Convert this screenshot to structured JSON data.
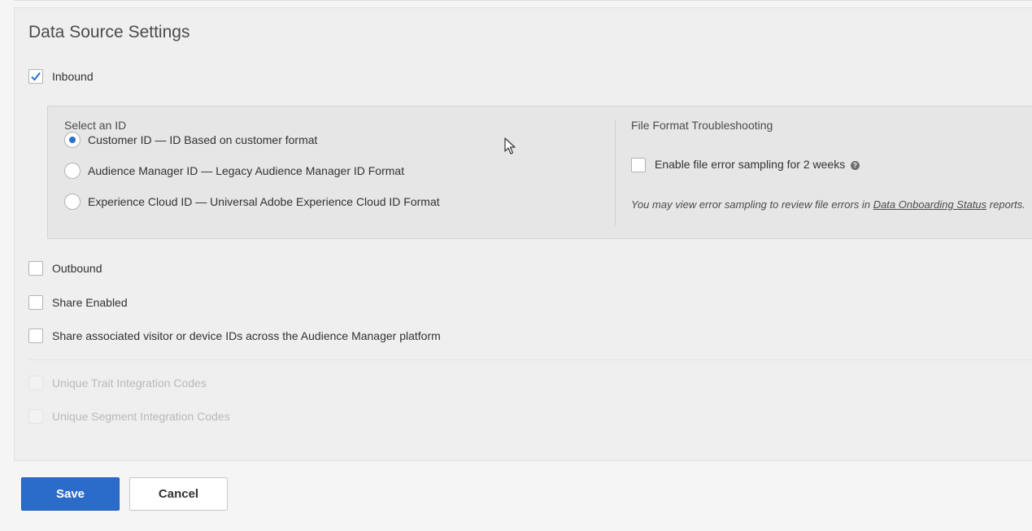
{
  "panel": {
    "title": "Data Source Settings"
  },
  "inbound": {
    "label": "Inbound",
    "checked": true,
    "select_id": {
      "label": "Select an ID",
      "options": [
        {
          "label": "Customer ID — ID Based on customer format",
          "selected": true
        },
        {
          "label": "Audience Manager ID — Legacy Audience Manager ID Format",
          "selected": false
        },
        {
          "label": "Experience Cloud ID — Universal Adobe Experience Cloud ID Format",
          "selected": false
        }
      ]
    },
    "troubleshooting": {
      "title": "File Format Troubleshooting",
      "error_sampling_label": "Enable file error sampling for 2 weeks",
      "help_icon": "question-circle-icon",
      "note_prefix": "You may view error sampling to review file errors in",
      "note_link": "Data Onboarding Status",
      "note_suffix": "reports."
    }
  },
  "options": {
    "outbound": "Outbound",
    "share_enabled": "Share Enabled",
    "share_ids": "Share associated visitor or device IDs across the Audience Manager platform",
    "unique_trait": "Unique Trait Integration Codes",
    "unique_segment": "Unique Segment Integration Codes"
  },
  "buttons": {
    "save": "Save",
    "cancel": "Cancel"
  },
  "colors": {
    "primary": "#2b6ccb",
    "radio_selected": "#2d6ed1",
    "checkmark": "#2d6ed1"
  }
}
